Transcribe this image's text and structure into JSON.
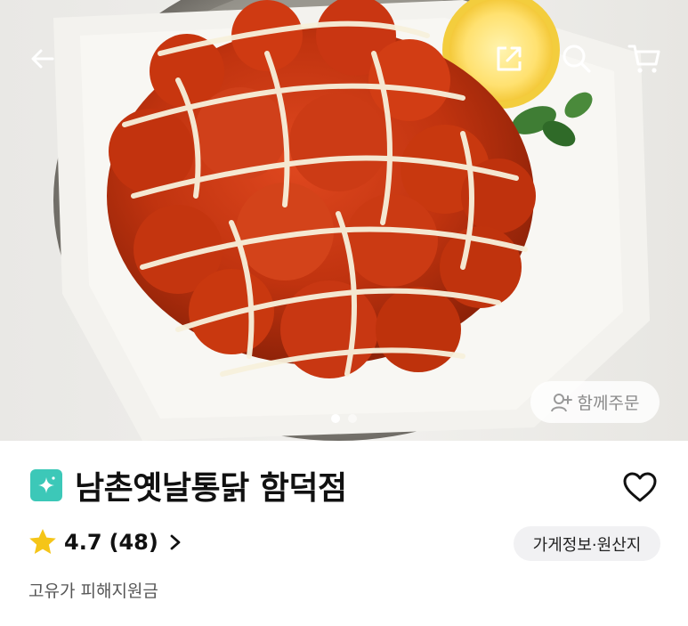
{
  "hero": {
    "image_alt": "yangnyeom chicken on a plate",
    "page_dots": 2,
    "active_dot": 0,
    "group_order_label": "함께주문"
  },
  "topbar": {
    "back_icon": "arrow-left-icon",
    "share_icon": "share-icon",
    "search_icon": "search-icon",
    "cart_icon": "cart-icon"
  },
  "store": {
    "name": "남촌옛날통닭 함덕점",
    "badge_color": "#3cc8b8",
    "rating": "4.7",
    "review_count": "(48)",
    "info_button_label": "가게정보·원산지",
    "support_text": "고유가 피해지원금"
  },
  "colors": {
    "star": "#f5c518",
    "accent": "#3cc8b8"
  }
}
